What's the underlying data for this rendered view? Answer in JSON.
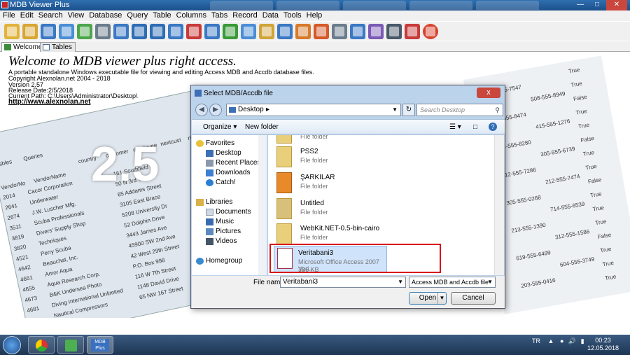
{
  "window": {
    "title": "MDB Viewer Plus"
  },
  "menu": [
    "File",
    "Edit",
    "Search",
    "View",
    "Database",
    "Query",
    "Table",
    "Columns",
    "Tabs",
    "Record",
    "Data",
    "Tools",
    "Help"
  ],
  "toolbar_icons": [
    "open-folder-icon",
    "refresh-folder-icon",
    "query-icon",
    "find-icon",
    "add-table-icon",
    "database-icon",
    "export-icon",
    "chart-icon",
    "info-icon",
    "insert-record-icon",
    "delete-record-icon",
    "edit-icon",
    "text-compare-icon",
    "columns-icon",
    "lock-icon",
    "grid-icon",
    "sort-icon",
    "tag-icon",
    "print-icon",
    "convert-icon",
    "server-icon",
    "compare-icon",
    "pdf-icon",
    "stop-icon"
  ],
  "tabs": [
    {
      "label": "Welcome"
    },
    {
      "label": "Tables"
    }
  ],
  "welcome": {
    "title": "Welcome to MDB viewer plus right access.",
    "description": "A portable standalone Windows executable file for viewing and editing Access MDB and Accdb database files.",
    "copyright": "Copyright   Alexnolan.net 2004 - 2018",
    "version": "Version 2.57",
    "release": "Release Date:2/5/2018",
    "path": "Current Path: C:\\Users\\Administrator\\Desktop\\",
    "link": "http://www.alexnolan.net",
    "big_version": "2.5"
  },
  "bg_table": {
    "tabs": [
      "Tables",
      "Queries"
    ],
    "headers": [
      "VendorNo",
      "VendorName",
      "country",
      "customer",
      "employee",
      "nextcust",
      "nextitem"
    ],
    "rows": [
      [
        "2014",
        "Cacor Corporation",
        "161 Southfield Rd"
      ],
      [
        "2641",
        "Underwater",
        "50 N 3rd Street"
      ],
      [
        "2674",
        "J.W. Luscher Mfg.",
        "65 Addams Street"
      ],
      [
        "3511",
        "Scuba Professionals",
        "3105 East Brace"
      ],
      [
        "3819",
        "Divers' Supply Shop",
        "5208 University Dr"
      ],
      [
        "3820",
        "Techniques",
        "52 Dolphin Drive"
      ],
      [
        "4521",
        "Perry Scuba",
        "3443 James Ave"
      ],
      [
        "4642",
        "Beauchat, Inc.",
        "45900 SW 2nd Ave"
      ],
      [
        "4651",
        "Amor Aqua",
        "42 West 29th Street"
      ],
      [
        "4655",
        "Aqua Research Corp.",
        "P.O. Box 998"
      ],
      [
        "4673",
        "B&K Undersea Photo",
        "116 W 7th Street"
      ],
      [
        "4681",
        "Diving International Unlimited",
        "1148 David Drive"
      ],
      [
        "",
        "Nautical Compressors",
        "65 NW 167 Street"
      ]
    ],
    "right_phones": [
      "708-555-7547",
      "508-555-8949",
      "912-555-8474",
      "415-555-1276",
      "404-555-8280",
      "305-555-6739",
      "212-555-7286",
      "212-555-7474",
      "305-555-0268",
      "714-555-6539",
      "213-555-1390",
      "312-555-1586",
      "619-555-6499",
      "604-555-3749",
      "203-555-0416"
    ],
    "right_flags": [
      "True",
      "True",
      "False",
      "True",
      "True",
      "False",
      "True",
      "True",
      "False",
      "True",
      "True",
      "True",
      "False",
      "True",
      "True",
      "True"
    ]
  },
  "dialog": {
    "title": "Select MDB/Accdb file",
    "close": "x",
    "address": "Desktop",
    "search_placeholder": "Search Desktop",
    "commands": {
      "organize": "Organize ▾",
      "new_folder": "New folder"
    },
    "nav": {
      "favorites": "Favorites",
      "fav_items": [
        "Desktop",
        "Recent Places",
        "Downloads",
        "Catch!"
      ],
      "libraries": "Libraries",
      "lib_items": [
        "Documents",
        "Music",
        "Pictures",
        "Videos"
      ],
      "homegroup": "Homegroup"
    },
    "files": [
      {
        "name": "",
        "type": "File folder",
        "size": ""
      },
      {
        "name": "PSS2",
        "type": "File folder",
        "size": ""
      },
      {
        "name": "ŞARKILAR",
        "type": "File folder",
        "size": ""
      },
      {
        "name": "Untitled",
        "type": "File folder",
        "size": ""
      },
      {
        "name": "WebKit.NET-0.5-bin-cairo",
        "type": "File folder",
        "size": ""
      },
      {
        "name": "Veritabani3",
        "type": "Microsoft Office Access 2007 Veri...",
        "size": "336 KB"
      }
    ],
    "file_name_label": "File name:",
    "file_name_value": "Veritabani3",
    "file_type": "Access MDB and Accdb file",
    "open_button": "Open",
    "cancel_button": "Cancel"
  },
  "taskbar": {
    "lang": "TR",
    "time": "00:23",
    "date": "12.05.2018",
    "app_label": "MDB Plus"
  }
}
